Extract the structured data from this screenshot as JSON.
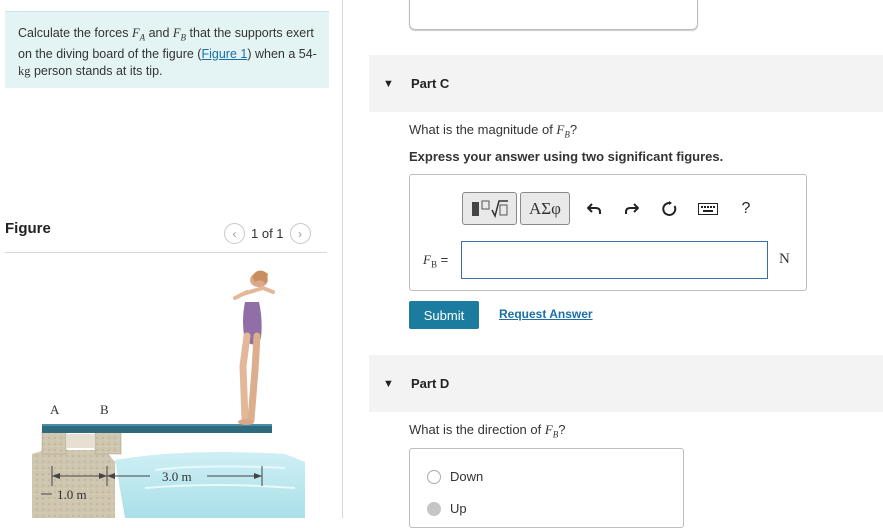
{
  "problem": {
    "text_before": "Calculate the forces ",
    "fa_sym": "F",
    "fa_sub": "A",
    "and_word": " and ",
    "fb_sym": "F",
    "fb_sub": "B",
    "text_mid": " that the supports exert on the diving board of the figure (",
    "figure_link": "Figure 1",
    "text_mid2": ") when a 54-",
    "kg": "kg",
    "text_end": " person stands at its tip."
  },
  "figure": {
    "heading": "Figure",
    "pager_text": "1 of 1",
    "prev_icon": "chevron-left-icon",
    "next_icon": "chevron-right-icon",
    "label_a": "A",
    "label_b": "B",
    "dim_long": "3.0 m",
    "dim_short": "1.0 m"
  },
  "partC": {
    "title": "Part C",
    "question_before": "What is the magnitude of ",
    "question_sym": "F",
    "question_sub": "B",
    "question_after": "?",
    "instruction": "Express your answer using two significant figures.",
    "toolbar": {
      "greek_label": "ΑΣφ",
      "help_label": "?",
      "icons": [
        "template-icon",
        "undo-icon",
        "redo-icon",
        "reset-icon",
        "keyboard-icon",
        "help-icon"
      ]
    },
    "answer_sym": "F",
    "answer_sub": "B",
    "answer_eq": " =",
    "answer_value": "",
    "unit": "N",
    "submit_label": "Submit",
    "request_label": "Request Answer"
  },
  "partD": {
    "title": "Part D",
    "question_before": "What is the direction of ",
    "question_sym": "F",
    "question_sub": "B",
    "question_after": "?",
    "choices": [
      {
        "label": "Down",
        "selected": false
      },
      {
        "label": "Up",
        "selected": false
      }
    ]
  },
  "colors": {
    "problem_bg": "#e4f4f5",
    "link": "#1a6fa8",
    "submit_bg": "#1c7ca0",
    "part_header_bg": "#f3f3f3"
  }
}
